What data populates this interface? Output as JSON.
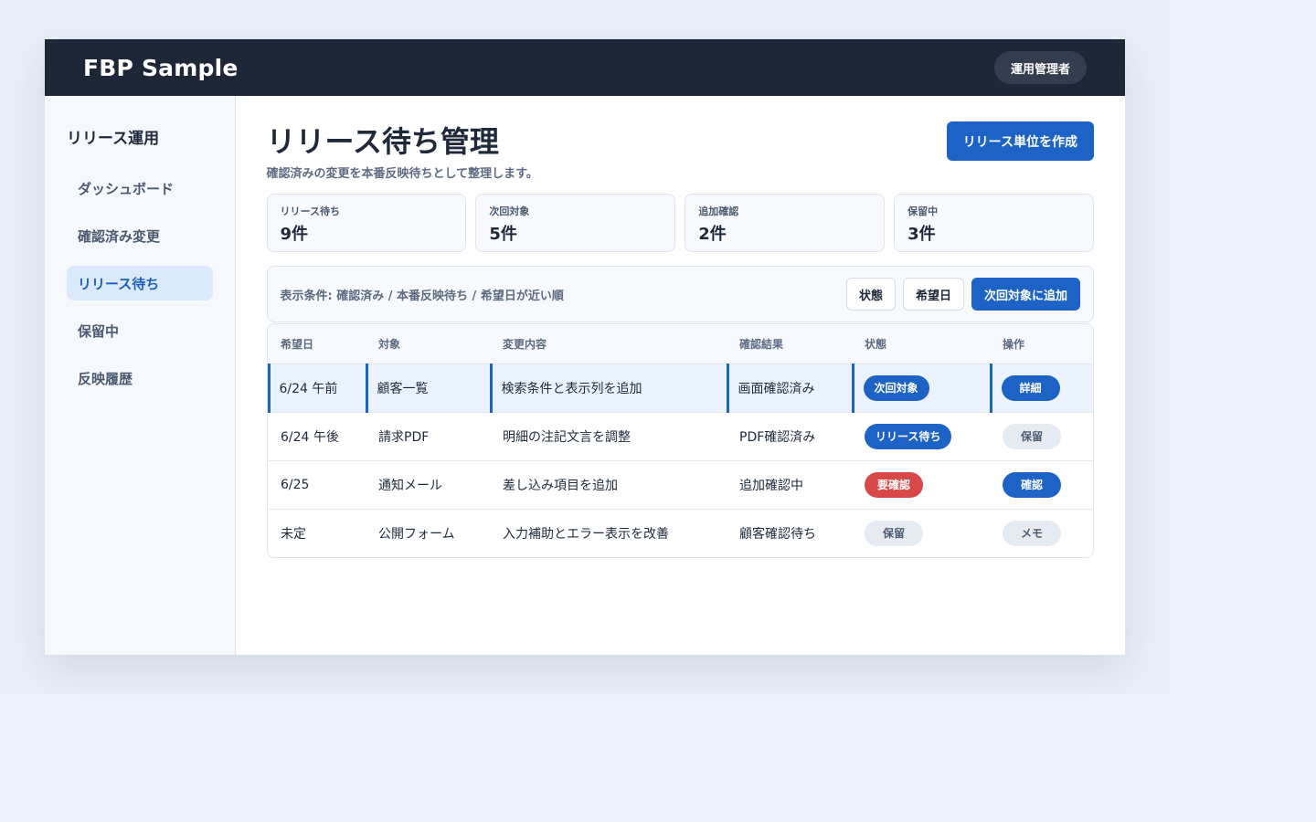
{
  "app": {
    "title": "FBP Sample",
    "user_label": "運用管理者"
  },
  "sidebar": {
    "title": "リリース運用",
    "items": [
      {
        "label": "ダッシュボード",
        "active": false
      },
      {
        "label": "確認済み変更",
        "active": false
      },
      {
        "label": "リリース待ち",
        "active": true
      },
      {
        "label": "保留中",
        "active": false
      },
      {
        "label": "反映履歴",
        "active": false
      }
    ]
  },
  "main": {
    "title": "リリース待ち管理",
    "subtitle": "確認済みの変更を本番反映待ちとして整理します。",
    "create_button": "リリース単位を作成",
    "stats": [
      {
        "label": "リリース待ち",
        "value": "9件"
      },
      {
        "label": "次回対象",
        "value": "5件"
      },
      {
        "label": "追加確認",
        "value": "2件"
      },
      {
        "label": "保留中",
        "value": "3件"
      }
    ],
    "filter": {
      "text": "表示条件: 確認済み / 本番反映待ち / 希望日が近い順",
      "status_button": "状態",
      "date_button": "希望日",
      "add_button": "次回対象に追加"
    },
    "table": {
      "columns": [
        "希望日",
        "対象",
        "変更内容",
        "確認結果",
        "状態",
        "操作"
      ],
      "rows": [
        {
          "date": "6/24 午前",
          "target": "顧客一覧",
          "change": "検索条件と表示列を追加",
          "result": "画面確認済み",
          "status": "次回対象",
          "status_color": "#1d63c5",
          "action": "詳細",
          "action_color": "#1d63c5",
          "selected": true
        },
        {
          "date": "6/24 午後",
          "target": "請求PDF",
          "change": "明細の注記文言を調整",
          "result": "PDF確認済み",
          "status": "リリース待ち",
          "status_color": "#1d63c5",
          "action": "保留",
          "action_color": "#e6ebf2",
          "selected": false
        },
        {
          "date": "6/25",
          "target": "通知メール",
          "change": "差し込み項目を追加",
          "result": "追加確認中",
          "status": "要確認",
          "status_color": "#d94848",
          "action": "確認",
          "action_color": "#1d63c5",
          "selected": false
        },
        {
          "date": "未定",
          "target": "公開フォーム",
          "change": "入力補助とエラー表示を改善",
          "result": "顧客確認待ち",
          "status": "保留",
          "status_color": "#e6ebf2",
          "action": "メモ",
          "action_color": "#e6ebf2",
          "selected": false
        }
      ]
    }
  }
}
